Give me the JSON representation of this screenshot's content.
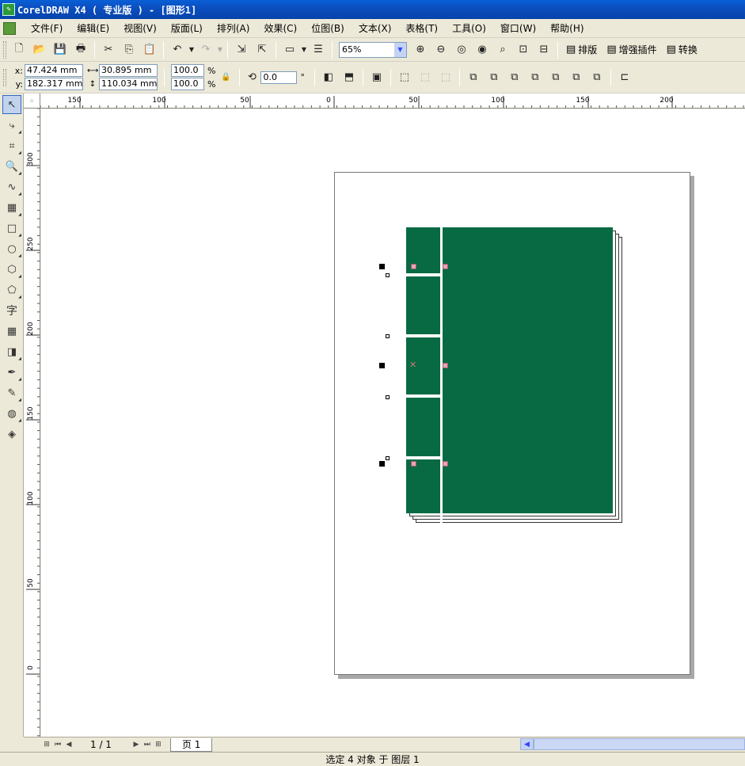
{
  "titlebar": {
    "title": "CorelDRAW X4 ( 专业版 ) - [图形1]"
  },
  "menubar": {
    "items": [
      "文件(F)",
      "编辑(E)",
      "视图(V)",
      "版面(L)",
      "排列(A)",
      "效果(C)",
      "位图(B)",
      "文本(X)",
      "表格(T)",
      "工具(O)",
      "窗口(W)",
      "帮助(H)"
    ]
  },
  "toolbar": {
    "zoom": "65%",
    "typeset_label": "排版",
    "enhance_label": "增强插件",
    "convert_label": "转换"
  },
  "propertybar": {
    "x_label": "x:",
    "x_value": "47.424 mm",
    "y_label": "y:",
    "y_value": "182.317 mm",
    "width_value": "30.895 mm",
    "height_value": "110.034 mm",
    "scale_x": "100.0",
    "scale_y": "100.0",
    "percent": "%",
    "rotation": "0.0",
    "degree": "°"
  },
  "ruler": {
    "h_ticks": [
      {
        "label": "150",
        "pos": 101
      },
      {
        "label": "100",
        "pos": 208
      },
      {
        "label": "50",
        "pos": 316
      },
      {
        "label": "0",
        "pos": 422
      },
      {
        "label": "50",
        "pos": 529
      },
      {
        "label": "100",
        "pos": 636
      },
      {
        "label": "150",
        "pos": 743
      },
      {
        "label": "200",
        "pos": 849
      }
    ],
    "v_ticks": [
      {
        "label": "300",
        "pos": 209
      },
      {
        "label": "250",
        "pos": 316
      },
      {
        "label": "200",
        "pos": 423
      },
      {
        "label": "150",
        "pos": 530
      },
      {
        "label": "100",
        "pos": 637
      },
      {
        "label": "50",
        "pos": 744
      },
      {
        "label": "0",
        "pos": 851
      }
    ]
  },
  "navigation": {
    "page_count": "1 / 1",
    "page_tab": "页 1"
  },
  "status": {
    "text": "选定 4 对象 于 图层 1"
  },
  "colors": {
    "book_green": "#076a43",
    "title_blue": "#0b4fc0"
  }
}
